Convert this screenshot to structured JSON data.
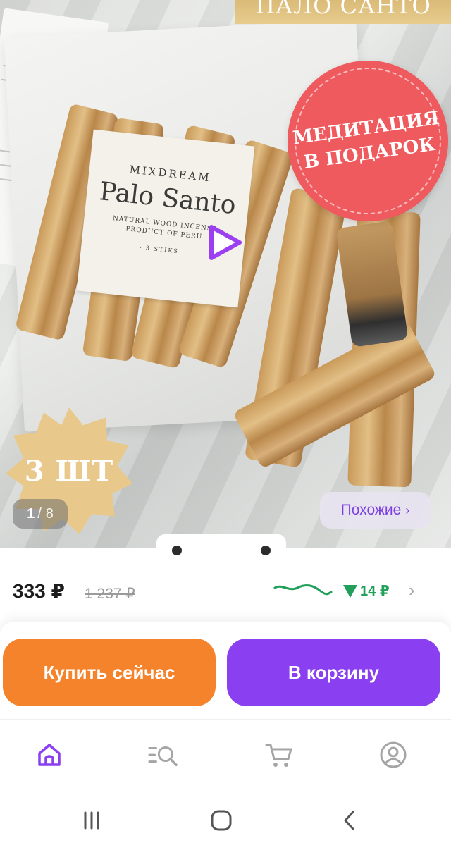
{
  "gallery": {
    "top_banner_text": "ПАЛО САНТО",
    "promo_line1": "МЕДИТАЦИЯ",
    "promo_line2": "В ПОДАРОК",
    "badge_text": "3 ШТ",
    "package_label": {
      "brand": "MIXDREAM",
      "title": "Palo Santo",
      "subtitle_line1": "NATURAL WOOD INCENSE",
      "subtitle_line2": "PRODUCT OF PERU",
      "count_text": "- 3 STIKS -"
    },
    "counter_current": "1",
    "counter_separator": "/",
    "counter_total": "8",
    "similar_button_label": "Похожие",
    "similar_button_chevron": "›",
    "play_icon": "play-icon"
  },
  "price": {
    "current": "333 ₽",
    "old": "1 237 ₽",
    "drop_amount": "14 ₽",
    "drop_color": "#22a05b",
    "chevron": "›"
  },
  "actions": {
    "buy_now_label": "Купить сейчас",
    "buy_now_color": "#f5832b",
    "add_to_cart_label": "В корзину",
    "add_to_cart_color": "#8a3ff0"
  },
  "bottom_nav": {
    "items": [
      {
        "icon": "home-icon",
        "active": true
      },
      {
        "icon": "catalog-search-icon",
        "active": false
      },
      {
        "icon": "cart-icon",
        "active": false
      },
      {
        "icon": "profile-icon",
        "active": false
      }
    ],
    "accent": "#8a3ff0"
  },
  "system_nav": {
    "items": [
      "recent-apps-icon",
      "home-button-icon",
      "back-icon"
    ]
  }
}
